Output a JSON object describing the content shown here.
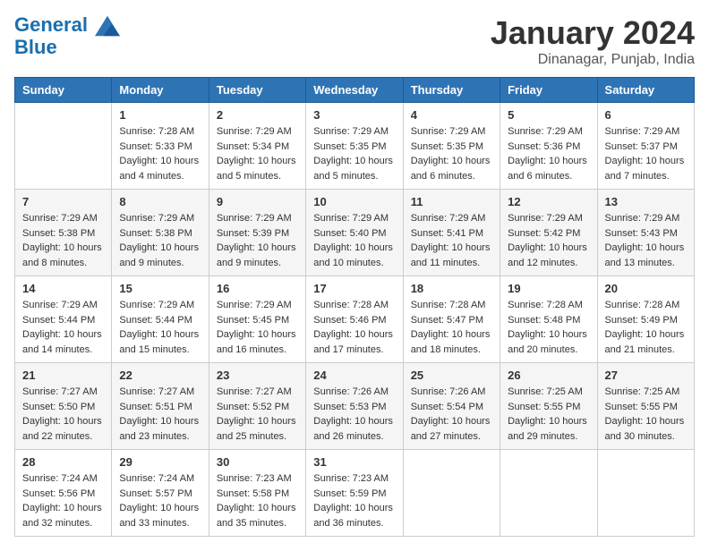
{
  "logo": {
    "line1": "General",
    "line2": "Blue"
  },
  "title": "January 2024",
  "location": "Dinanagar, Punjab, India",
  "columns": [
    "Sunday",
    "Monday",
    "Tuesday",
    "Wednesday",
    "Thursday",
    "Friday",
    "Saturday"
  ],
  "weeks": [
    [
      {
        "day": "",
        "sunrise": "",
        "sunset": "",
        "daylight": ""
      },
      {
        "day": "1",
        "sunrise": "Sunrise: 7:28 AM",
        "sunset": "Sunset: 5:33 PM",
        "daylight": "Daylight: 10 hours and 4 minutes."
      },
      {
        "day": "2",
        "sunrise": "Sunrise: 7:29 AM",
        "sunset": "Sunset: 5:34 PM",
        "daylight": "Daylight: 10 hours and 5 minutes."
      },
      {
        "day": "3",
        "sunrise": "Sunrise: 7:29 AM",
        "sunset": "Sunset: 5:35 PM",
        "daylight": "Daylight: 10 hours and 5 minutes."
      },
      {
        "day": "4",
        "sunrise": "Sunrise: 7:29 AM",
        "sunset": "Sunset: 5:35 PM",
        "daylight": "Daylight: 10 hours and 6 minutes."
      },
      {
        "day": "5",
        "sunrise": "Sunrise: 7:29 AM",
        "sunset": "Sunset: 5:36 PM",
        "daylight": "Daylight: 10 hours and 6 minutes."
      },
      {
        "day": "6",
        "sunrise": "Sunrise: 7:29 AM",
        "sunset": "Sunset: 5:37 PM",
        "daylight": "Daylight: 10 hours and 7 minutes."
      }
    ],
    [
      {
        "day": "7",
        "sunrise": "Sunrise: 7:29 AM",
        "sunset": "Sunset: 5:38 PM",
        "daylight": "Daylight: 10 hours and 8 minutes."
      },
      {
        "day": "8",
        "sunrise": "Sunrise: 7:29 AM",
        "sunset": "Sunset: 5:38 PM",
        "daylight": "Daylight: 10 hours and 9 minutes."
      },
      {
        "day": "9",
        "sunrise": "Sunrise: 7:29 AM",
        "sunset": "Sunset: 5:39 PM",
        "daylight": "Daylight: 10 hours and 9 minutes."
      },
      {
        "day": "10",
        "sunrise": "Sunrise: 7:29 AM",
        "sunset": "Sunset: 5:40 PM",
        "daylight": "Daylight: 10 hours and 10 minutes."
      },
      {
        "day": "11",
        "sunrise": "Sunrise: 7:29 AM",
        "sunset": "Sunset: 5:41 PM",
        "daylight": "Daylight: 10 hours and 11 minutes."
      },
      {
        "day": "12",
        "sunrise": "Sunrise: 7:29 AM",
        "sunset": "Sunset: 5:42 PM",
        "daylight": "Daylight: 10 hours and 12 minutes."
      },
      {
        "day": "13",
        "sunrise": "Sunrise: 7:29 AM",
        "sunset": "Sunset: 5:43 PM",
        "daylight": "Daylight: 10 hours and 13 minutes."
      }
    ],
    [
      {
        "day": "14",
        "sunrise": "Sunrise: 7:29 AM",
        "sunset": "Sunset: 5:44 PM",
        "daylight": "Daylight: 10 hours and 14 minutes."
      },
      {
        "day": "15",
        "sunrise": "Sunrise: 7:29 AM",
        "sunset": "Sunset: 5:44 PM",
        "daylight": "Daylight: 10 hours and 15 minutes."
      },
      {
        "day": "16",
        "sunrise": "Sunrise: 7:29 AM",
        "sunset": "Sunset: 5:45 PM",
        "daylight": "Daylight: 10 hours and 16 minutes."
      },
      {
        "day": "17",
        "sunrise": "Sunrise: 7:28 AM",
        "sunset": "Sunset: 5:46 PM",
        "daylight": "Daylight: 10 hours and 17 minutes."
      },
      {
        "day": "18",
        "sunrise": "Sunrise: 7:28 AM",
        "sunset": "Sunset: 5:47 PM",
        "daylight": "Daylight: 10 hours and 18 minutes."
      },
      {
        "day": "19",
        "sunrise": "Sunrise: 7:28 AM",
        "sunset": "Sunset: 5:48 PM",
        "daylight": "Daylight: 10 hours and 20 minutes."
      },
      {
        "day": "20",
        "sunrise": "Sunrise: 7:28 AM",
        "sunset": "Sunset: 5:49 PM",
        "daylight": "Daylight: 10 hours and 21 minutes."
      }
    ],
    [
      {
        "day": "21",
        "sunrise": "Sunrise: 7:27 AM",
        "sunset": "Sunset: 5:50 PM",
        "daylight": "Daylight: 10 hours and 22 minutes."
      },
      {
        "day": "22",
        "sunrise": "Sunrise: 7:27 AM",
        "sunset": "Sunset: 5:51 PM",
        "daylight": "Daylight: 10 hours and 23 minutes."
      },
      {
        "day": "23",
        "sunrise": "Sunrise: 7:27 AM",
        "sunset": "Sunset: 5:52 PM",
        "daylight": "Daylight: 10 hours and 25 minutes."
      },
      {
        "day": "24",
        "sunrise": "Sunrise: 7:26 AM",
        "sunset": "Sunset: 5:53 PM",
        "daylight": "Daylight: 10 hours and 26 minutes."
      },
      {
        "day": "25",
        "sunrise": "Sunrise: 7:26 AM",
        "sunset": "Sunset: 5:54 PM",
        "daylight": "Daylight: 10 hours and 27 minutes."
      },
      {
        "day": "26",
        "sunrise": "Sunrise: 7:25 AM",
        "sunset": "Sunset: 5:55 PM",
        "daylight": "Daylight: 10 hours and 29 minutes."
      },
      {
        "day": "27",
        "sunrise": "Sunrise: 7:25 AM",
        "sunset": "Sunset: 5:55 PM",
        "daylight": "Daylight: 10 hours and 30 minutes."
      }
    ],
    [
      {
        "day": "28",
        "sunrise": "Sunrise: 7:24 AM",
        "sunset": "Sunset: 5:56 PM",
        "daylight": "Daylight: 10 hours and 32 minutes."
      },
      {
        "day": "29",
        "sunrise": "Sunrise: 7:24 AM",
        "sunset": "Sunset: 5:57 PM",
        "daylight": "Daylight: 10 hours and 33 minutes."
      },
      {
        "day": "30",
        "sunrise": "Sunrise: 7:23 AM",
        "sunset": "Sunset: 5:58 PM",
        "daylight": "Daylight: 10 hours and 35 minutes."
      },
      {
        "day": "31",
        "sunrise": "Sunrise: 7:23 AM",
        "sunset": "Sunset: 5:59 PM",
        "daylight": "Daylight: 10 hours and 36 minutes."
      },
      {
        "day": "",
        "sunrise": "",
        "sunset": "",
        "daylight": ""
      },
      {
        "day": "",
        "sunrise": "",
        "sunset": "",
        "daylight": ""
      },
      {
        "day": "",
        "sunrise": "",
        "sunset": "",
        "daylight": ""
      }
    ]
  ]
}
